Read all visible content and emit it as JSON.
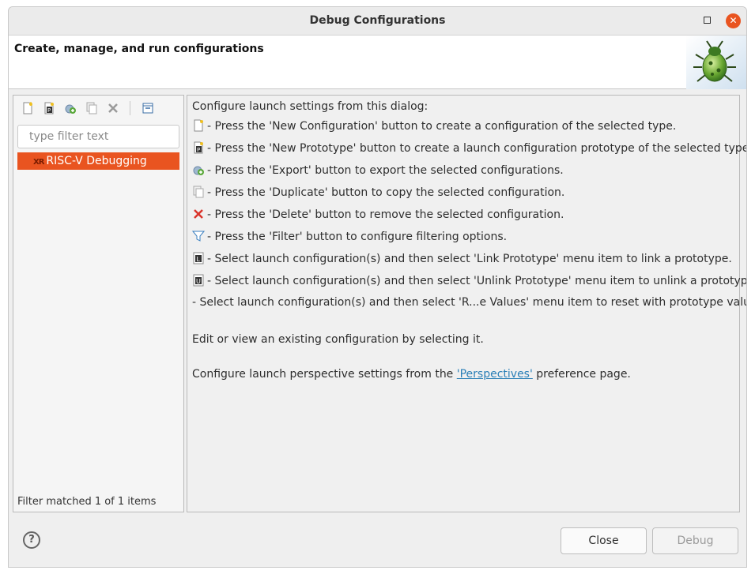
{
  "window": {
    "title": "Debug Configurations"
  },
  "header": {
    "title": "Create, manage, and run configurations"
  },
  "toolbar": {
    "icons": [
      "new-configuration-icon",
      "new-prototype-icon",
      "export-icon",
      "duplicate-icon",
      "delete-icon",
      "collapse-all-icon"
    ]
  },
  "sidebar": {
    "filter_placeholder": "type filter text",
    "items": [
      {
        "label": "RISC-V Debugging",
        "badge": "XR"
      }
    ],
    "filter_status": "Filter matched 1 of 1 items"
  },
  "content": {
    "intro": "Configure launch settings from this dialog:",
    "instructions": [
      {
        "icon": "new-configuration-icon",
        "text": "- Press the 'New Configuration' button to create a configuration of the selected type."
      },
      {
        "icon": "new-prototype-icon",
        "text": "- Press the 'New Prototype' button to create a launch configuration prototype of the selected type."
      },
      {
        "icon": "export-icon",
        "text": "- Press the 'Export' button to export the selected configurations."
      },
      {
        "icon": "duplicate-icon",
        "text": "- Press the 'Duplicate' button to copy the selected configuration."
      },
      {
        "icon": "delete-icon",
        "text": "- Press the 'Delete' button to remove the selected configuration."
      },
      {
        "icon": "filter-icon",
        "text": "- Press the 'Filter' button to configure filtering options."
      },
      {
        "icon": "link-prototype-icon",
        "text": "- Select launch configuration(s) and then select 'Link Prototype' menu item to link a prototype."
      },
      {
        "icon": "unlink-prototype-icon",
        "text": "- Select launch configuration(s) and then select 'Unlink Prototype' menu item to unlink a prototype."
      },
      {
        "icon": "",
        "text": "- Select launch configuration(s) and then select 'R...e Values' menu item to reset with prototype values."
      }
    ],
    "edit_note": "Edit or view an existing configuration by selecting it.",
    "perspective_prefix": "Configure launch perspective settings from the ",
    "perspective_link": "'Perspectives'",
    "perspective_suffix": " preference page."
  },
  "footer": {
    "help_label": "?",
    "close_label": "Close",
    "debug_label": "Debug"
  },
  "colors": {
    "accent": "#e95420",
    "link": "#2a7fb7"
  }
}
